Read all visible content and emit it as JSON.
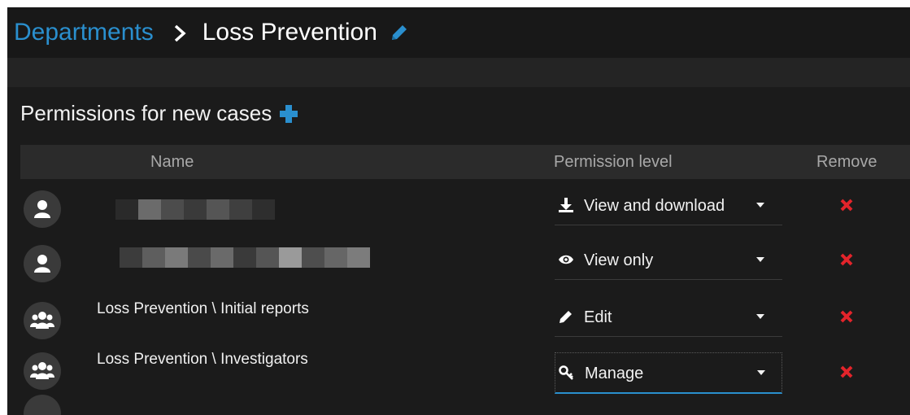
{
  "breadcrumb": {
    "parent": "Departments",
    "current": "Loss Prevention"
  },
  "section": {
    "title": "Permissions for new cases"
  },
  "table": {
    "headers": {
      "name": "Name",
      "permission": "Permission level",
      "remove": "Remove"
    },
    "rows": [
      {
        "type": "user",
        "name": "",
        "permission": "View and download",
        "perm_icon": "download-icon"
      },
      {
        "type": "user",
        "name": "",
        "permission": "View only",
        "perm_icon": "eye-icon"
      },
      {
        "type": "group",
        "name": "Loss Prevention \\ Initial reports",
        "permission": "Edit",
        "perm_icon": "pencil-icon"
      },
      {
        "type": "group",
        "name": "Loss Prevention \\ Investigators",
        "permission": "Manage",
        "perm_icon": "key-icon"
      }
    ]
  },
  "colors": {
    "accent": "#2a8fce",
    "remove": "#e3242b",
    "background": "#1b1b1b"
  }
}
